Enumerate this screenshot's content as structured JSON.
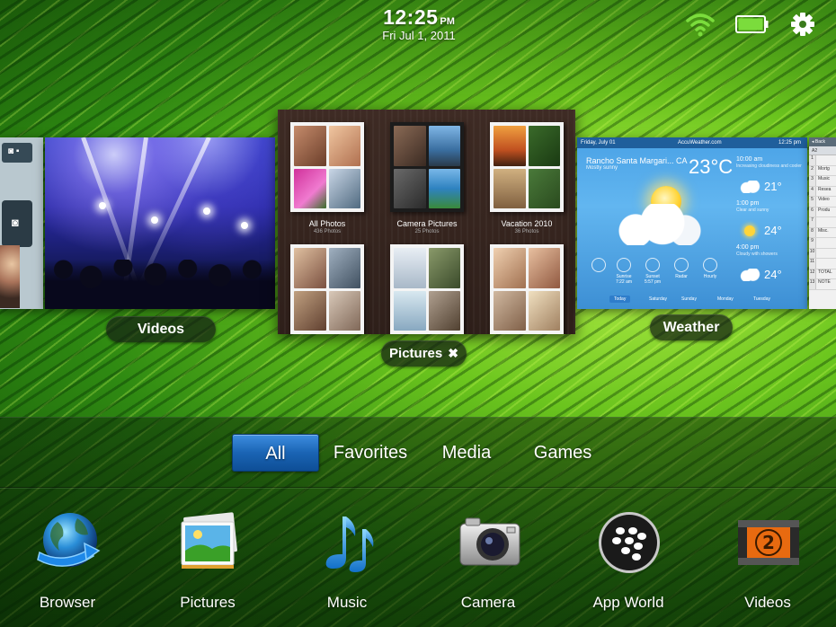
{
  "status": {
    "time": "12:25",
    "ampm": "PM",
    "date": "Fri Jul 1, 2011",
    "icons": [
      "wifi-icon",
      "battery-icon",
      "gear-icon"
    ],
    "battery_color": "#7bdc3c"
  },
  "cards": {
    "pictures": {
      "label": "Pictures",
      "close_icon": "✖",
      "albums": [
        {
          "title": "All Photos",
          "count": "436 Photos"
        },
        {
          "title": "Camera Pictures",
          "count": "25 Photos"
        },
        {
          "title": "Vacation 2010",
          "count": "36 Photos"
        },
        {
          "title": "",
          "count": ""
        },
        {
          "title": "",
          "count": ""
        },
        {
          "title": "",
          "count": ""
        }
      ]
    },
    "videos": {
      "label": "Videos"
    },
    "weather": {
      "label": "Weather",
      "header_left": "Friday, July 01",
      "header_center": "AccuWeather.com",
      "header_right": "12:25 pm",
      "city": "Rancho Santa Margari... CA",
      "condition": "Mostly sunny",
      "temp": "23°C",
      "forecast": [
        {
          "time": "10:00 am",
          "desc": "Increasing cloudiness and cooler",
          "temp": "21°"
        },
        {
          "time": "1:00 pm",
          "desc": "Clear and sunny",
          "temp": "24°"
        },
        {
          "time": "4:00 pm",
          "desc": "Cloudy with showers",
          "temp": "24°"
        }
      ],
      "details": [
        {
          "label": "",
          "value": ""
        },
        {
          "label": "Sunrise",
          "value": "7:22 am"
        },
        {
          "label": "Sunset",
          "value": "5:57 pm"
        },
        {
          "label": "Radar",
          "value": ""
        },
        {
          "label": "Hourly",
          "value": ""
        }
      ],
      "days": [
        "Today",
        "Saturday",
        "Sunday",
        "Monday",
        "Tuesday"
      ]
    },
    "spreadsheet": {
      "back": "Back",
      "cell": "A2",
      "rows": [
        {
          "n": "1",
          "t": ""
        },
        {
          "n": "2",
          "t": "Mortg"
        },
        {
          "n": "3",
          "t": "Music"
        },
        {
          "n": "4",
          "t": "Resea"
        },
        {
          "n": "5",
          "t": "Video"
        },
        {
          "n": "6",
          "t": "Produ"
        },
        {
          "n": "7",
          "t": ""
        },
        {
          "n": "8",
          "t": "Misc."
        },
        {
          "n": "9",
          "t": ""
        },
        {
          "n": "10",
          "t": ""
        },
        {
          "n": "11",
          "t": ""
        },
        {
          "n": "12",
          "t": "TOTAL"
        },
        {
          "n": "13",
          "t": "NOTE"
        }
      ]
    }
  },
  "tabs": [
    {
      "label": "All",
      "active": true
    },
    {
      "label": "Favorites",
      "active": false
    },
    {
      "label": "Media",
      "active": false
    },
    {
      "label": "Games",
      "active": false
    }
  ],
  "apps": [
    {
      "label": "Browser",
      "icon": "globe-icon"
    },
    {
      "label": "Pictures",
      "icon": "photos-icon"
    },
    {
      "label": "Music",
      "icon": "music-note-icon"
    },
    {
      "label": "Camera",
      "icon": "camera-icon"
    },
    {
      "label": "App World",
      "icon": "blackberry-icon"
    },
    {
      "label": "Videos",
      "icon": "film-icon"
    }
  ]
}
